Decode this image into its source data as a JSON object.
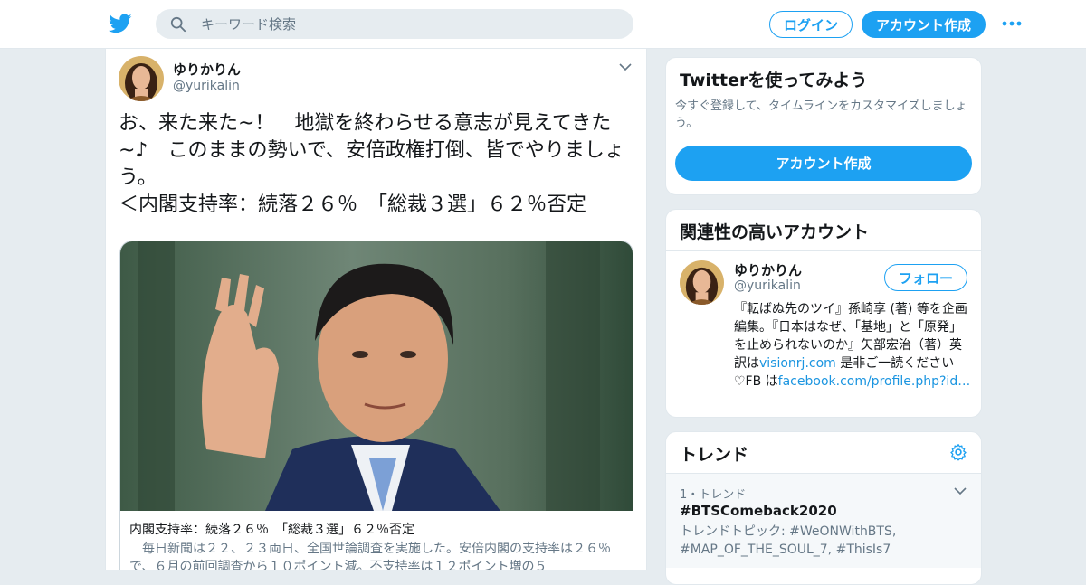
{
  "header": {
    "search_placeholder": "キーワード検索",
    "login_label": "ログイン",
    "signup_label": "アカウント作成"
  },
  "tweet": {
    "name": "ゆりかりん",
    "handle": "@yurikalin",
    "text": "お、来た来た~！　地獄を終わらせる意志が見えてきた~♪　このままの勢いで、安倍政権打倒、皆でやりましょう。\n＜内閣支持率：続落２６％　「総裁３選」６２％否定",
    "card": {
      "title": "内閣支持率：続落２６％　「総裁３選」６２％否定",
      "description": "　毎日新聞は２２、２３両日、全国世論調査を実施した。安倍内閣の支持率は２６％で、６月の前回調査から１０ポイント減。不支持率は１２ポイント増の５"
    }
  },
  "signup_panel": {
    "title": "Twitterを使ってみよう",
    "subtitle": "今すぐ登録して、タイムラインをカスタマイズしましょう。",
    "button_label": "アカウント作成"
  },
  "related_panel": {
    "title": "関連性の高いアカウント",
    "account": {
      "name": "ゆりかりん",
      "handle": "@yurikalin",
      "follow_label": "フォロー",
      "bio_part1": "『転ばぬ先のツイ』孫崎享 (著) 等を企画編集。『日本はなぜ、「基地」と「原発」を止められないのか』矢部宏治（著）英訳は",
      "bio_link1": "visionrj.com",
      "bio_part2": " 是非ご一読ください♡FB は",
      "bio_link2": "facebook.com/profile.php?id…"
    }
  },
  "trends_panel": {
    "title": "トレンド",
    "items": [
      {
        "meta": "1・トレンド",
        "name": "#BTSComeback2020",
        "description": "トレンドトピック: #WeONWithBTS, #MAP_OF_THE_SOUL_7, #ThisIs7"
      }
    ]
  },
  "colors": {
    "accent": "#1da1f2",
    "background": "#e6ecf0",
    "secondary_text": "#657786"
  }
}
